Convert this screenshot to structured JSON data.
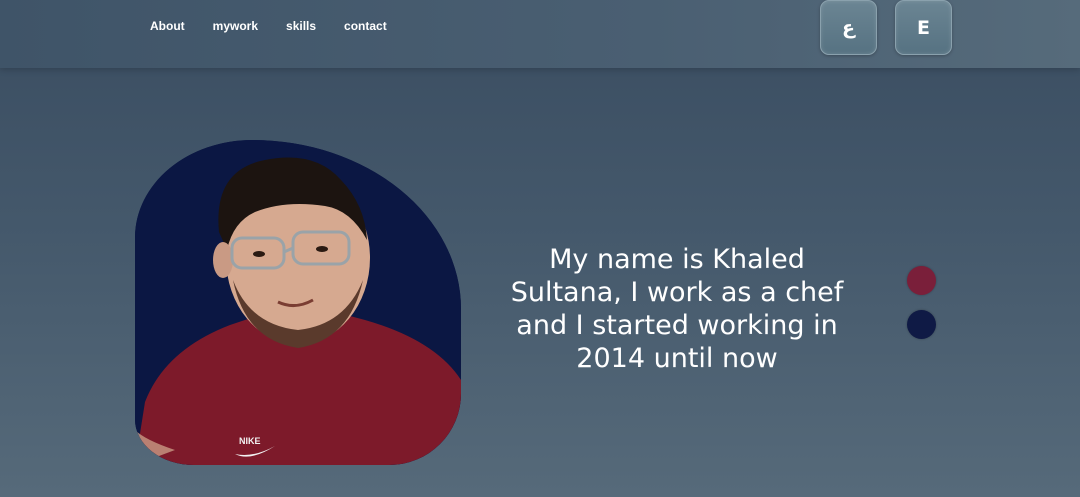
{
  "nav": {
    "items": [
      {
        "label": "About"
      },
      {
        "label": "mywork"
      },
      {
        "label": "skills"
      },
      {
        "label": "contact"
      }
    ]
  },
  "language": {
    "arabic_label": "ع",
    "english_label": "E"
  },
  "hero": {
    "photo_icon": "profile-photo",
    "shirt_logo_text": "NIKE",
    "bio_text": "My name is Khaled Sultana, I work as a chef and I started working in 2014 until now"
  },
  "theme": {
    "dot_colors": [
      "#7a1f3a",
      "#0f1a45"
    ]
  }
}
